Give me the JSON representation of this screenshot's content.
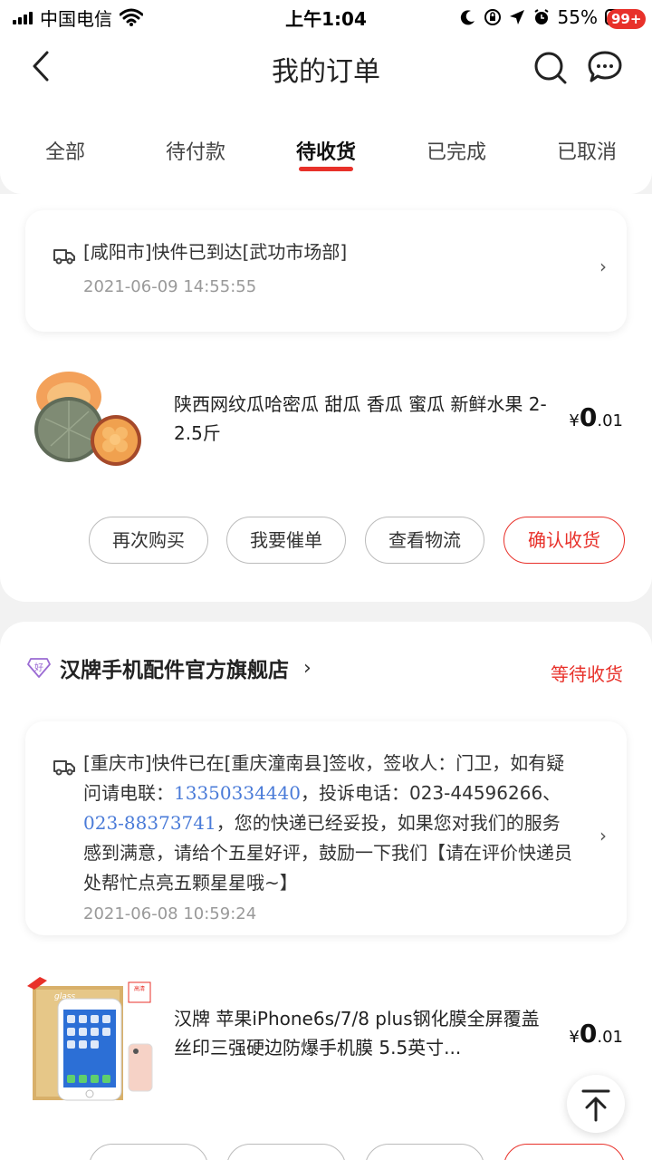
{
  "statusbar": {
    "carrier": "中国电信",
    "time": "上午1:04",
    "battery": "55%"
  },
  "nav": {
    "title": "我的订单",
    "badge": "99+"
  },
  "tabs": [
    {
      "label": "全部"
    },
    {
      "label": "待付款"
    },
    {
      "label": "待收货",
      "active": true
    },
    {
      "label": "已完成"
    },
    {
      "label": "已取消"
    }
  ],
  "order1": {
    "logistics": {
      "text": "[咸阳市]快件已到达[武功市场部]",
      "time": "2021-06-09 14:55:55"
    },
    "product": {
      "name": "陕西网纹瓜哈密瓜 甜瓜 香瓜 蜜瓜 新鲜水果 2-2.5斤",
      "currency": "¥",
      "price_int": "0",
      "price_dec": ".01"
    },
    "buttons": {
      "rebuy": "再次购买",
      "urge": "我要催单",
      "track": "查看物流",
      "confirm": "确认收货"
    }
  },
  "order2": {
    "shop": {
      "badge_char": "好",
      "name": "汉牌手机配件官方旗舰店",
      "arrow": "›",
      "status": "等待收货"
    },
    "logistics": {
      "part1": "[重庆市]快件已在[重庆潼南县]签收，签收人：门卫，如有疑问请电联：",
      "phone1": "13350334440",
      "part2": "，投诉电话：",
      "phone2": "023-44596266",
      "sep": "、",
      "phone3": "023-88373741",
      "part3": "，您的快递已经妥投，如果您对我们的服务感到满意，请给个五星好评，鼓励一下我们【请在评价快递员处帮忙点亮五颗星星哦~】",
      "time": "2021-06-08 10:59:24"
    },
    "product": {
      "name": "汉牌 苹果iPhone6s/7/8 plus钢化膜全屏覆盖丝印三强硬边防爆手机膜 5.5英寸...",
      "currency": "¥",
      "price_int": "0",
      "price_dec": ".01",
      "box_label": "glass",
      "box_tag": "高清全屏"
    }
  },
  "colors": {
    "accent": "#e8312a",
    "link": "#4a7bd8",
    "background": "#f2f2f2"
  }
}
